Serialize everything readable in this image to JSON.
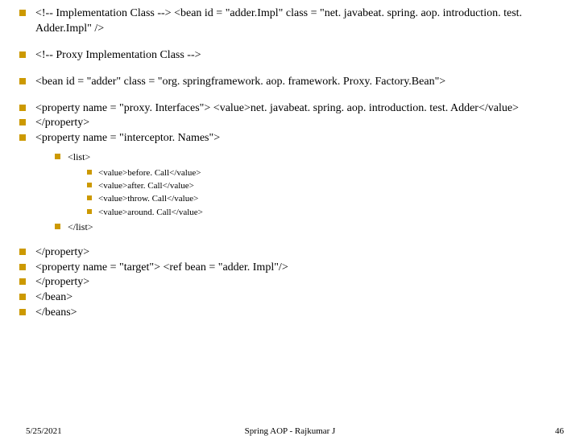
{
  "items": {
    "i0": "<!-- Implementation Class --> <bean id = \"adder.Impl\" class = \"net. javabeat. spring. aop. introduction. test. Adder.Impl\" />",
    "i1": "<!-- Proxy Implementation Class -->",
    "i2": "<bean id = \"adder\" class = \"org. springframework. aop. framework. Proxy. Factory.Bean\">",
    "i3": "<property name = \"proxy. Interfaces\"> <value>net. javabeat. spring. aop. introduction. test. Adder</value>",
    "i4": "</property>",
    "i5": "<property name = \"interceptor. Names\">",
    "i6": "<list>",
    "i7": "<value>before. Call</value>",
    "i8": "<value>after. Call</value>",
    "i9": "<value>throw. Call</value>",
    "i10": "<value>around. Call</value>",
    "i11": "</list>",
    "i12": "</property>",
    "i13": "<property name = \"target\"> <ref bean = \"adder. Impl\"/>",
    "i14": "</property>",
    "i15": "</bean>",
    "i16": "</beans>"
  },
  "footer": {
    "date": "5/25/2021",
    "title": "Spring AOP - Rajkumar J",
    "page": "46"
  }
}
